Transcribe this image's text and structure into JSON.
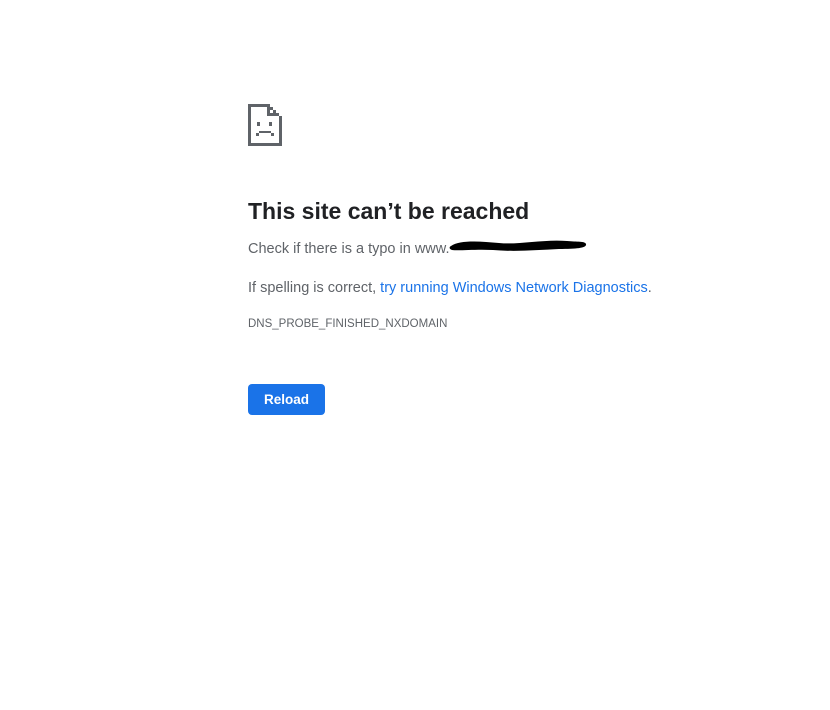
{
  "error": {
    "icon": "sad-page-icon",
    "title": "This site can’t be reached",
    "typo_prefix": "Check if there is a typo in www.",
    "spelling_prefix": "If spelling is correct, ",
    "diagnostics_link": "try running Windows Network Diagnostics",
    "spelling_suffix": ".",
    "code": "DNS_PROBE_FINISHED_NXDOMAIN"
  },
  "reload_button": {
    "label": "Reload",
    "color": "#1a73e8"
  },
  "colors": {
    "title": "#202124",
    "body_text": "#5f6368",
    "link": "#1a73e8",
    "redaction": "#000000"
  }
}
